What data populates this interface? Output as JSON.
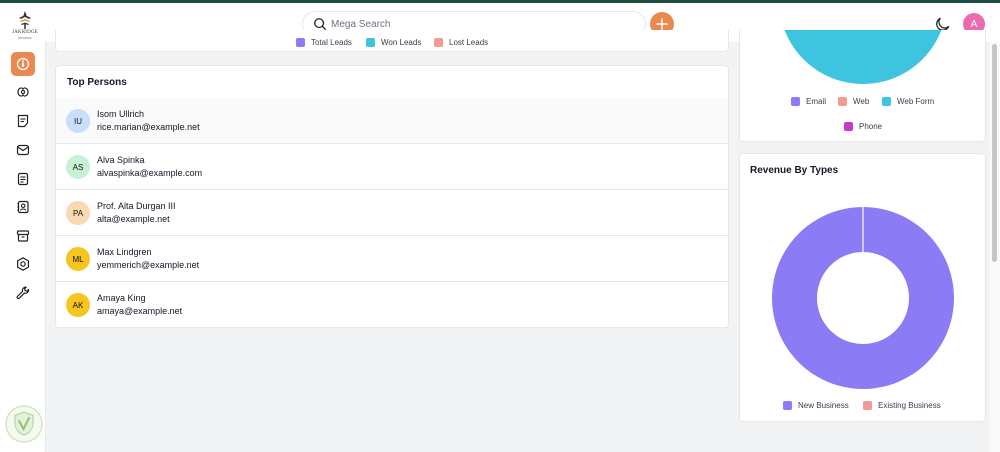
{
  "app": {
    "logo_text": "JAKRIDGE",
    "logo_sub": "ESTATES"
  },
  "header": {
    "search_placeholder": "Mega Search",
    "avatar_initial": "A"
  },
  "colors": {
    "accent": "#e9884f",
    "purple": "#8b7cf6",
    "cyan": "#3ec4df",
    "salmon": "#f49a95",
    "magenta": "#c53ac9",
    "avatar_pink": "#ec6bb0"
  },
  "sidebar": {
    "items": [
      {
        "name": "dashboard-icon",
        "active": true
      },
      {
        "name": "leads-icon",
        "active": false
      },
      {
        "name": "quotes-icon",
        "active": false
      },
      {
        "name": "mail-icon",
        "active": false
      },
      {
        "name": "activities-icon",
        "active": false
      },
      {
        "name": "contacts-icon",
        "active": false
      },
      {
        "name": "products-icon",
        "active": false
      },
      {
        "name": "settings-icon",
        "active": false
      },
      {
        "name": "configuration-icon",
        "active": false
      }
    ]
  },
  "leads_legend": [
    {
      "label": "Total Leads",
      "color": "#8b7cf6"
    },
    {
      "label": "Won Leads",
      "color": "#3ec4df"
    },
    {
      "label": "Lost Leads",
      "color": "#f49a95"
    }
  ],
  "top_persons": {
    "title": "Top Persons",
    "persons": [
      {
        "initials": "IU",
        "name": "Isom Ullrich",
        "email": "rice.marian@example.net",
        "color": "#c9def8"
      },
      {
        "initials": "AS",
        "name": "Alva Spinka",
        "email": "alvaspinka@example.com",
        "color": "#c7f0d4"
      },
      {
        "initials": "PA",
        "name": "Prof. Alta Durgan III",
        "email": "alta@example.net",
        "color": "#f8d9b2"
      },
      {
        "initials": "ML",
        "name": "Max Lindgren",
        "email": "yemmerich@example.net",
        "color": "#f6c521"
      },
      {
        "initials": "AK",
        "name": "Amaya King",
        "email": "amaya@example.net",
        "color": "#f6c521"
      }
    ]
  },
  "source_legend": [
    {
      "label": "Email",
      "color": "#8b7cf6"
    },
    {
      "label": "Web",
      "color": "#f49a95"
    },
    {
      "label": "Web Form",
      "color": "#3ec4df"
    },
    {
      "label": "Phone",
      "color": "#c53ac9"
    }
  ],
  "revenue": {
    "title": "Revenue By Types",
    "legend": [
      {
        "label": "New Business",
        "color": "#8b7cf6"
      },
      {
        "label": "Existing Business",
        "color": "#f49a95"
      }
    ]
  },
  "chart_data": [
    {
      "type": "pie",
      "title": "",
      "categories": [
        "Email",
        "Web",
        "Web Form",
        "Phone"
      ],
      "values": [
        0,
        0,
        100,
        0
      ]
    },
    {
      "type": "pie",
      "title": "Revenue By Types",
      "categories": [
        "New Business",
        "Existing Business"
      ],
      "values": [
        100,
        0
      ]
    }
  ]
}
